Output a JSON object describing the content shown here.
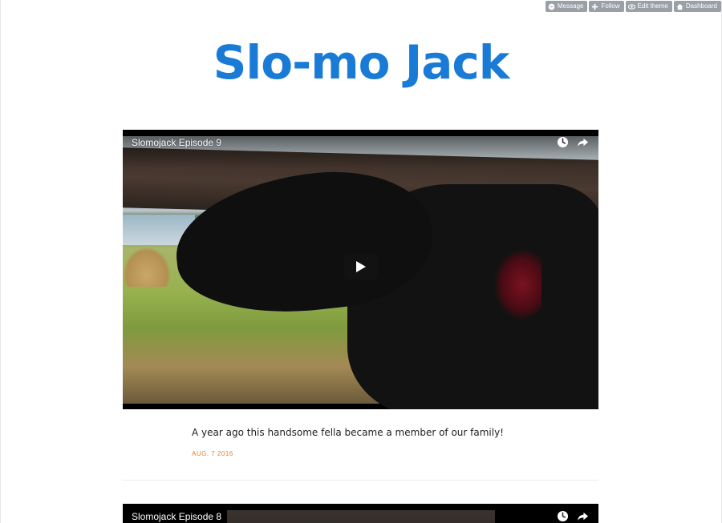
{
  "controls": {
    "message": "Message",
    "follow": "Follow",
    "edit_theme": "Edit theme",
    "dashboard": "Dashboard"
  },
  "blog": {
    "title": "Slo-mo Jack"
  },
  "posts": [
    {
      "video_title": "Slomojack Episode 9",
      "caption": "A year ago this handsome fella became a member of our family!",
      "date": "AUG. 7 2016"
    },
    {
      "video_title": "Slomojack Episode 8"
    }
  ],
  "colors": {
    "title": "#1a7bd6",
    "date": "#e8802a",
    "control_bg": "#9aa0a6"
  },
  "icons": {
    "video_toolbar": [
      "watch-later-icon",
      "share-icon"
    ],
    "center": "play-icon"
  }
}
